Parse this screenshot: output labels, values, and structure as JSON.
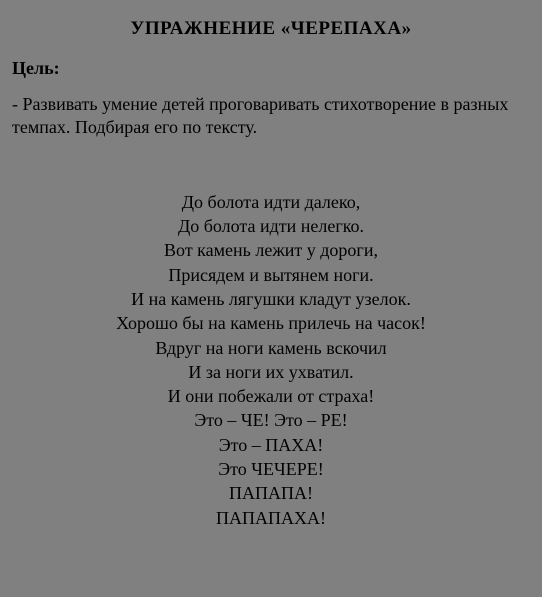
{
  "title": "УПРАЖНЕНИЕ «ЧЕРЕПАХА»",
  "goal_label": "Цель:",
  "goal_text": "- Развивать умение детей проговаривать стихотворение в разных темпах. Подбирая его по тексту.",
  "poem": {
    "lines": [
      "До болота идти далеко,",
      "До болота идти нелегко.",
      "Вот камень лежит у дороги,",
      "Присядем и вытянем ноги.",
      "И на камень лягушки кладут узелок.",
      "Хорошо бы на камень прилечь на часок!",
      "Вдруг на ноги камень вскочил",
      "И за ноги их ухватил.",
      "И они побежали от страха!",
      "Это – ЧЕ! Это – РЕ!",
      "Это – ПАХА!",
      "Это ЧЕЧЕРЕ!",
      "ПАПАПА!",
      "ПАПАПАХА!"
    ]
  }
}
